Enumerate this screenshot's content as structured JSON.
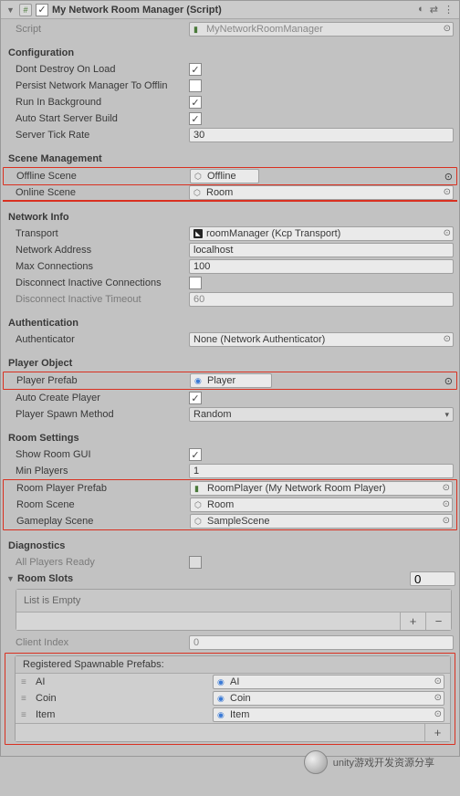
{
  "header": {
    "title": "My Network Room Manager (Script)",
    "enabled_check": "✓"
  },
  "script": {
    "label": "Script",
    "value": "MyNetworkRoomManager"
  },
  "configuration": {
    "title": "Configuration",
    "dont_destroy": {
      "label": "Dont Destroy On Load",
      "checked": "✓"
    },
    "persist_nm": {
      "label": "Persist Network Manager To Offlin",
      "checked": ""
    },
    "run_bg": {
      "label": "Run In Background",
      "checked": "✓"
    },
    "auto_start": {
      "label": "Auto Start Server Build",
      "checked": "✓"
    },
    "tick_rate": {
      "label": "Server Tick Rate",
      "value": "30"
    }
  },
  "scene_mgmt": {
    "title": "Scene Management",
    "offline": {
      "label": "Offline Scene",
      "value": "Offline"
    },
    "online": {
      "label": "Online Scene",
      "value": "Room"
    }
  },
  "network_info": {
    "title": "Network Info",
    "transport": {
      "label": "Transport",
      "value": "roomManager (Kcp Transport)"
    },
    "address": {
      "label": "Network Address",
      "value": "localhost"
    },
    "max_conn": {
      "label": "Max Connections",
      "value": "100"
    },
    "disc_inact": {
      "label": "Disconnect Inactive Connections",
      "checked": ""
    },
    "disc_timeout": {
      "label": "Disconnect Inactive Timeout",
      "value": "60"
    }
  },
  "auth": {
    "title": "Authentication",
    "authenticator": {
      "label": "Authenticator",
      "value": "None (Network Authenticator)"
    }
  },
  "player_obj": {
    "title": "Player Object",
    "prefab": {
      "label": "Player Prefab",
      "value": "Player"
    },
    "auto_create": {
      "label": "Auto Create Player",
      "checked": "✓"
    },
    "spawn_method": {
      "label": "Player Spawn Method",
      "value": "Random"
    }
  },
  "room_settings": {
    "title": "Room Settings",
    "show_gui": {
      "label": "Show Room GUI",
      "checked": "✓"
    },
    "min_players": {
      "label": "Min Players",
      "value": "1"
    },
    "room_player": {
      "label": "Room Player Prefab",
      "value": "RoomPlayer (My Network Room Player)"
    },
    "room_scene": {
      "label": "Room Scene",
      "value": "Room"
    },
    "game_scene": {
      "label": "Gameplay Scene",
      "value": "SampleScene"
    }
  },
  "diagnostics": {
    "title": "Diagnostics",
    "all_ready": {
      "label": "All Players Ready",
      "checked": ""
    }
  },
  "room_slots": {
    "label": "Room Slots",
    "count": "0",
    "empty_text": "List is Empty"
  },
  "client_index": {
    "label": "Client Index",
    "value": "0"
  },
  "spawnable": {
    "header": "Registered Spawnable Prefabs:",
    "items": [
      {
        "label": "AI",
        "value": "AI"
      },
      {
        "label": "Coin",
        "value": "Coin"
      },
      {
        "label": "Item",
        "value": "Item"
      }
    ]
  },
  "watermark": "unity游戏开发资源分享"
}
